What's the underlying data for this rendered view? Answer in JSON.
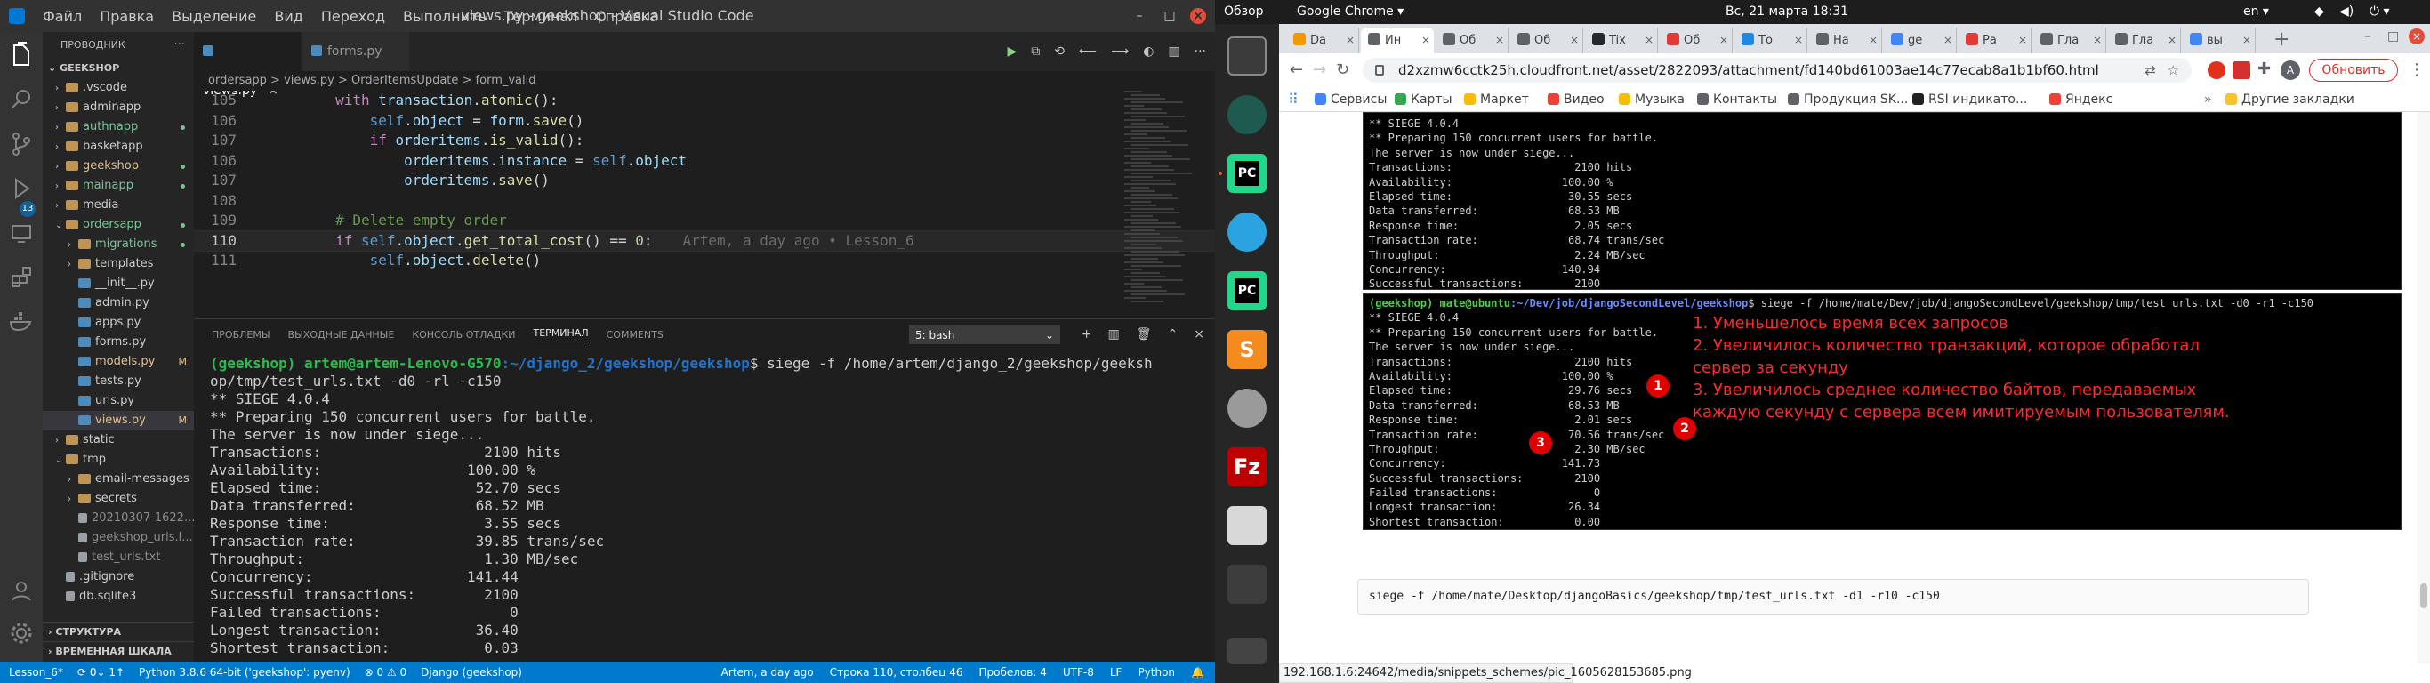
{
  "vscode": {
    "title": "views.py - geekshop - Visual Studio Code",
    "menu": [
      "Файл",
      "Правка",
      "Выделение",
      "Вид",
      "Переход",
      "Выполнить",
      "Терминал",
      "Справка"
    ],
    "explorer": {
      "header": "ПРОВОДНИК",
      "root": "GEEKSHOP",
      "tree": [
        {
          "label": ".vscode",
          "type": "folder",
          "depth": 1,
          "open": false,
          "mod": ""
        },
        {
          "label": "adminapp",
          "type": "folder",
          "depth": 1,
          "open": false,
          "mod": ""
        },
        {
          "label": "authnapp",
          "type": "folder",
          "depth": 1,
          "open": false,
          "mod": "dot"
        },
        {
          "label": "basketapp",
          "type": "folder",
          "depth": 1,
          "open": false,
          "mod": ""
        },
        {
          "label": "geekshop",
          "type": "folder",
          "depth": 1,
          "open": false,
          "mod": "dot"
        },
        {
          "label": "mainapp",
          "type": "folder",
          "depth": 1,
          "open": false,
          "mod": "dot"
        },
        {
          "label": "media",
          "type": "folder",
          "depth": 1,
          "open": false,
          "mod": ""
        },
        {
          "label": "ordersapp",
          "type": "folder",
          "depth": 1,
          "open": true,
          "mod": "dot"
        },
        {
          "label": "migrations",
          "type": "folder",
          "depth": 2,
          "open": false,
          "mod": "dot"
        },
        {
          "label": "templates",
          "type": "folder",
          "depth": 2,
          "open": false,
          "mod": ""
        },
        {
          "label": "__init__.py",
          "type": "py",
          "depth": 2,
          "open": false,
          "mod": ""
        },
        {
          "label": "admin.py",
          "type": "py",
          "depth": 2,
          "open": false,
          "mod": ""
        },
        {
          "label": "apps.py",
          "type": "py",
          "depth": 2,
          "open": false,
          "mod": ""
        },
        {
          "label": "forms.py",
          "type": "py",
          "depth": 2,
          "open": false,
          "mod": ""
        },
        {
          "label": "models.py",
          "type": "py",
          "depth": 2,
          "open": false,
          "mod": "M"
        },
        {
          "label": "tests.py",
          "type": "py",
          "depth": 2,
          "open": false,
          "mod": ""
        },
        {
          "label": "urls.py",
          "type": "py",
          "depth": 2,
          "open": false,
          "mod": ""
        },
        {
          "label": "views.py",
          "type": "py",
          "depth": 2,
          "open": false,
          "mod": "M",
          "active": true
        },
        {
          "label": "static",
          "type": "folder",
          "depth": 1,
          "open": false,
          "mod": ""
        },
        {
          "label": "tmp",
          "type": "folder",
          "depth": 1,
          "open": true,
          "mod": ""
        },
        {
          "label": "email-messages",
          "type": "folder",
          "depth": 2,
          "open": false,
          "mod": ""
        },
        {
          "label": "secrets",
          "type": "folder",
          "depth": 2,
          "open": false,
          "mod": ""
        },
        {
          "label": "20210307-1622...",
          "type": "file",
          "depth": 2,
          "open": false,
          "mod": ""
        },
        {
          "label": "geekshop_urls.l...",
          "type": "file",
          "depth": 2,
          "open": false,
          "mod": ""
        },
        {
          "label": "test_urls.txt",
          "type": "file",
          "depth": 2,
          "open": false,
          "mod": ""
        },
        {
          "label": ".gitignore",
          "type": "file",
          "depth": 1,
          "open": false,
          "mod": ""
        },
        {
          "label": "db.sqlite3",
          "type": "file",
          "depth": 1,
          "open": false,
          "mod": ""
        }
      ],
      "sections": [
        "СТРУКТУРА",
        "ВРЕМЕННАЯ ШКАЛА"
      ]
    },
    "tabs": [
      {
        "label": "views.py",
        "active": true
      },
      {
        "label": "forms.py",
        "active": false
      }
    ],
    "breadcrumb": "ordersapp > views.py > OrderItemsUpdate > form_valid",
    "code_lines": [
      {
        "num": "105",
        "text": "        with transaction.atomic():"
      },
      {
        "num": "106",
        "text": "            self.object = form.save()"
      },
      {
        "num": "107",
        "text": "            if orderitems.is_valid():"
      },
      {
        "num": "106",
        "text": "                orderitems.instance = self.object"
      },
      {
        "num": "107",
        "text": "                orderitems.save()"
      },
      {
        "num": "108",
        "text": ""
      },
      {
        "num": "109",
        "text": "        # Delete empty order"
      },
      {
        "num": "110",
        "text": "        if self.object.get_total_cost() == 0:",
        "ghost": "Artem, a day ago • Lesson_6",
        "current": true
      },
      {
        "num": "111",
        "text": "            self.object.delete()"
      }
    ],
    "panel_tabs": [
      "ПРОБЛЕМЫ",
      "ВЫХОДНЫЕ ДАННЫЕ",
      "КОНСОЛЬ ОТЛАДКИ",
      "ТЕРМИНАЛ",
      "COMMENTS"
    ],
    "active_panel_tab": "ТЕРМИНАЛ",
    "terminal_select": "5: bash",
    "terminal": {
      "prompt_user": "(geekshop) artem@artem-Lenovo-G570",
      "prompt_path": ":~/django_2/geekshop/geekshop",
      "command": "$ siege -f /home/artem/django_2/geekshop/geeksh",
      "command_cont": "op/tmp/test_urls.txt -d0 -rl -c150",
      "output": [
        "** SIEGE 4.0.4",
        "** Preparing 150 concurrent users for battle.",
        "The server is now under siege...",
        "Transactions:                   2100 hits",
        "Availability:                 100.00 %",
        "Elapsed time:                  52.70 secs",
        "Data transferred:              68.52 MB",
        "Response time:                  3.55 secs",
        "Transaction rate:              39.85 trans/sec",
        "Throughput:                     1.30 MB/sec",
        "Concurrency:                  141.44",
        "Successful transactions:        2100",
        "Failed transactions:               0",
        "Longest transaction:           36.40",
        "Shortest transaction:           0.03"
      ],
      "final_prompt_suffix": "$ "
    },
    "status_left": [
      "Lesson_6*",
      "⟳ 0↓ 1↑",
      "Python 3.8.6 64-bit ('geekshop': pyenv)",
      "⊗ 0 ⚠ 0",
      "Django (geekshop)"
    ],
    "status_right": [
      "Artem, a day ago",
      "Строка 110, столбец 46",
      "Пробелов: 4",
      "UTF-8",
      "LF",
      "Python"
    ]
  },
  "topbar": {
    "activities": "Обзор",
    "app": "Google Chrome ▾",
    "clock": "Вс, 21 марта  18:31",
    "lang": "en ▾"
  },
  "chrome": {
    "tabs": [
      {
        "label": "Da",
        "fav": "#f29900"
      },
      {
        "label": "Ин",
        "fav": "#5f6368",
        "active": true
      },
      {
        "label": "Об",
        "fav": "#5f6368"
      },
      {
        "label": "Об",
        "fav": "#5f6368"
      },
      {
        "label": "Tix",
        "fav": "#24292e"
      },
      {
        "label": "Об",
        "fav": "#e53935"
      },
      {
        "label": "То",
        "fav": "#1e88e5"
      },
      {
        "label": "На",
        "fav": "#5f6368"
      },
      {
        "label": "ge",
        "fav": "#4285f4"
      },
      {
        "label": "Ра",
        "fav": "#e53935"
      },
      {
        "label": "Гла",
        "fav": "#5f6368"
      },
      {
        "label": "Гла",
        "fav": "#5f6368"
      },
      {
        "label": "вы",
        "fav": "#4285f4"
      }
    ],
    "url": "d2xzmw6cctk25h.cloudfront.net/asset/2822093/attachment/fd140bd61003ae14c77ecab8a1b1bf60.html",
    "update_button": "Обновить",
    "bookmarks": [
      {
        "label": "Сервисы",
        "fav": "#4285f4"
      },
      {
        "label": "Карты",
        "fav": "#34a853"
      },
      {
        "label": "Маркет",
        "fav": "#fbbc04"
      },
      {
        "label": "Видео",
        "fav": "#ea4335"
      },
      {
        "label": "Музыка",
        "fav": "#fbbc04"
      },
      {
        "label": "Контакты",
        "fav": "#5f6368"
      },
      {
        "label": "Продукция SK...",
        "fav": "#5f6368"
      },
      {
        "label": "RSI индикато...",
        "fav": "#202124"
      },
      {
        "label": "Яндекс",
        "fav": "#ea4335"
      }
    ],
    "other_bookmarks": "Другие закладки",
    "status_url": "192.168.1.6:24642/media/snippets_schemes/pic_1605628153685.png",
    "shot1_lines": [
      "** SIEGE 4.0.4",
      "** Preparing 150 concurrent users for battle.",
      "The server is now under siege...",
      "Transactions:                   2100 hits",
      "Availability:                 100.00 %",
      "Elapsed time:                  30.55 secs",
      "Data transferred:              68.53 MB",
      "Response time:                  2.05 secs",
      "Transaction rate:              68.74 trans/sec",
      "Throughput:                     2.24 MB/sec",
      "Concurrency:                  140.94",
      "Successful transactions:        2100",
      "Failed transactions:               0",
      "Longest transaction:           26.75",
      "Shortest transaction:           0.00"
    ],
    "shot2_prompt_user": "(geekshop) mate@ubuntu",
    "shot2_prompt_path": ":~/Dev/job/djangoSecondLevel/geekshop",
    "shot2_command": "$ siege -f /home/mate/Dev/job/djangoSecondLevel/geekshop/tmp/test_urls.txt -d0 -r1 -c150",
    "shot2_lines": [
      "** SIEGE 4.0.4",
      "** Preparing 150 concurrent users for battle.",
      "The server is now under siege...",
      "Transactions:                   2100 hits",
      "Availability:                 100.00 %",
      "Elapsed time:                  29.76 secs",
      "Data transferred:              68.53 MB",
      "Response time:                  2.01 secs",
      "Transaction rate:              70.56 trans/sec",
      "Throughput:                     2.30 MB/sec",
      "Concurrency:                  141.73",
      "Successful transactions:        2100",
      "Failed transactions:               0",
      "Longest transaction:           26.34",
      "Shortest transaction:           0.00"
    ],
    "annotation": "1. Уменьшелось время всех запросов\n2. Увеличилось количество транзакций, которое обработал\nсервер за секунду\n3. Увеличилось среднее количество байтов, передаваемых\nкаждую секунду с сервера всем имитируемым пользователям.",
    "markers": [
      "1",
      "2",
      "3"
    ],
    "command_box": "siege -f /home/mate/Desktop/djangoBasics/geekshop/tmp/test_urls.txt -d1 -r10 -c150"
  }
}
